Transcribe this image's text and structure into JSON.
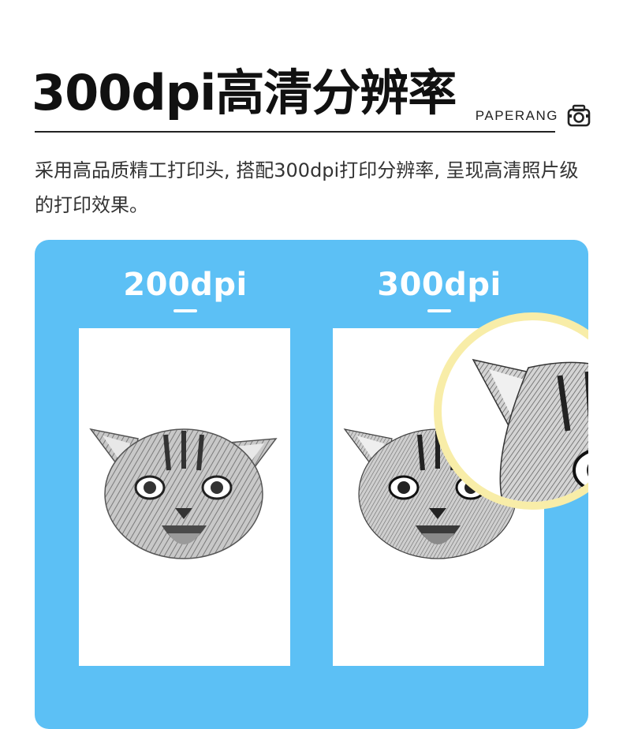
{
  "header": {
    "title": "300dpi高清分辨率",
    "brand": "PAPERANG",
    "brand_icon": "camera-icon"
  },
  "description": "采用高品质精工打印头, 搭配300dpi打印分辨率, 呈现高清照片级的打印效果。",
  "comparison": {
    "left": {
      "label": "200dpi"
    },
    "right": {
      "label": "300dpi"
    },
    "background_color": "#5cc0f5",
    "magnifier_ring_color": "#f8eda8"
  }
}
